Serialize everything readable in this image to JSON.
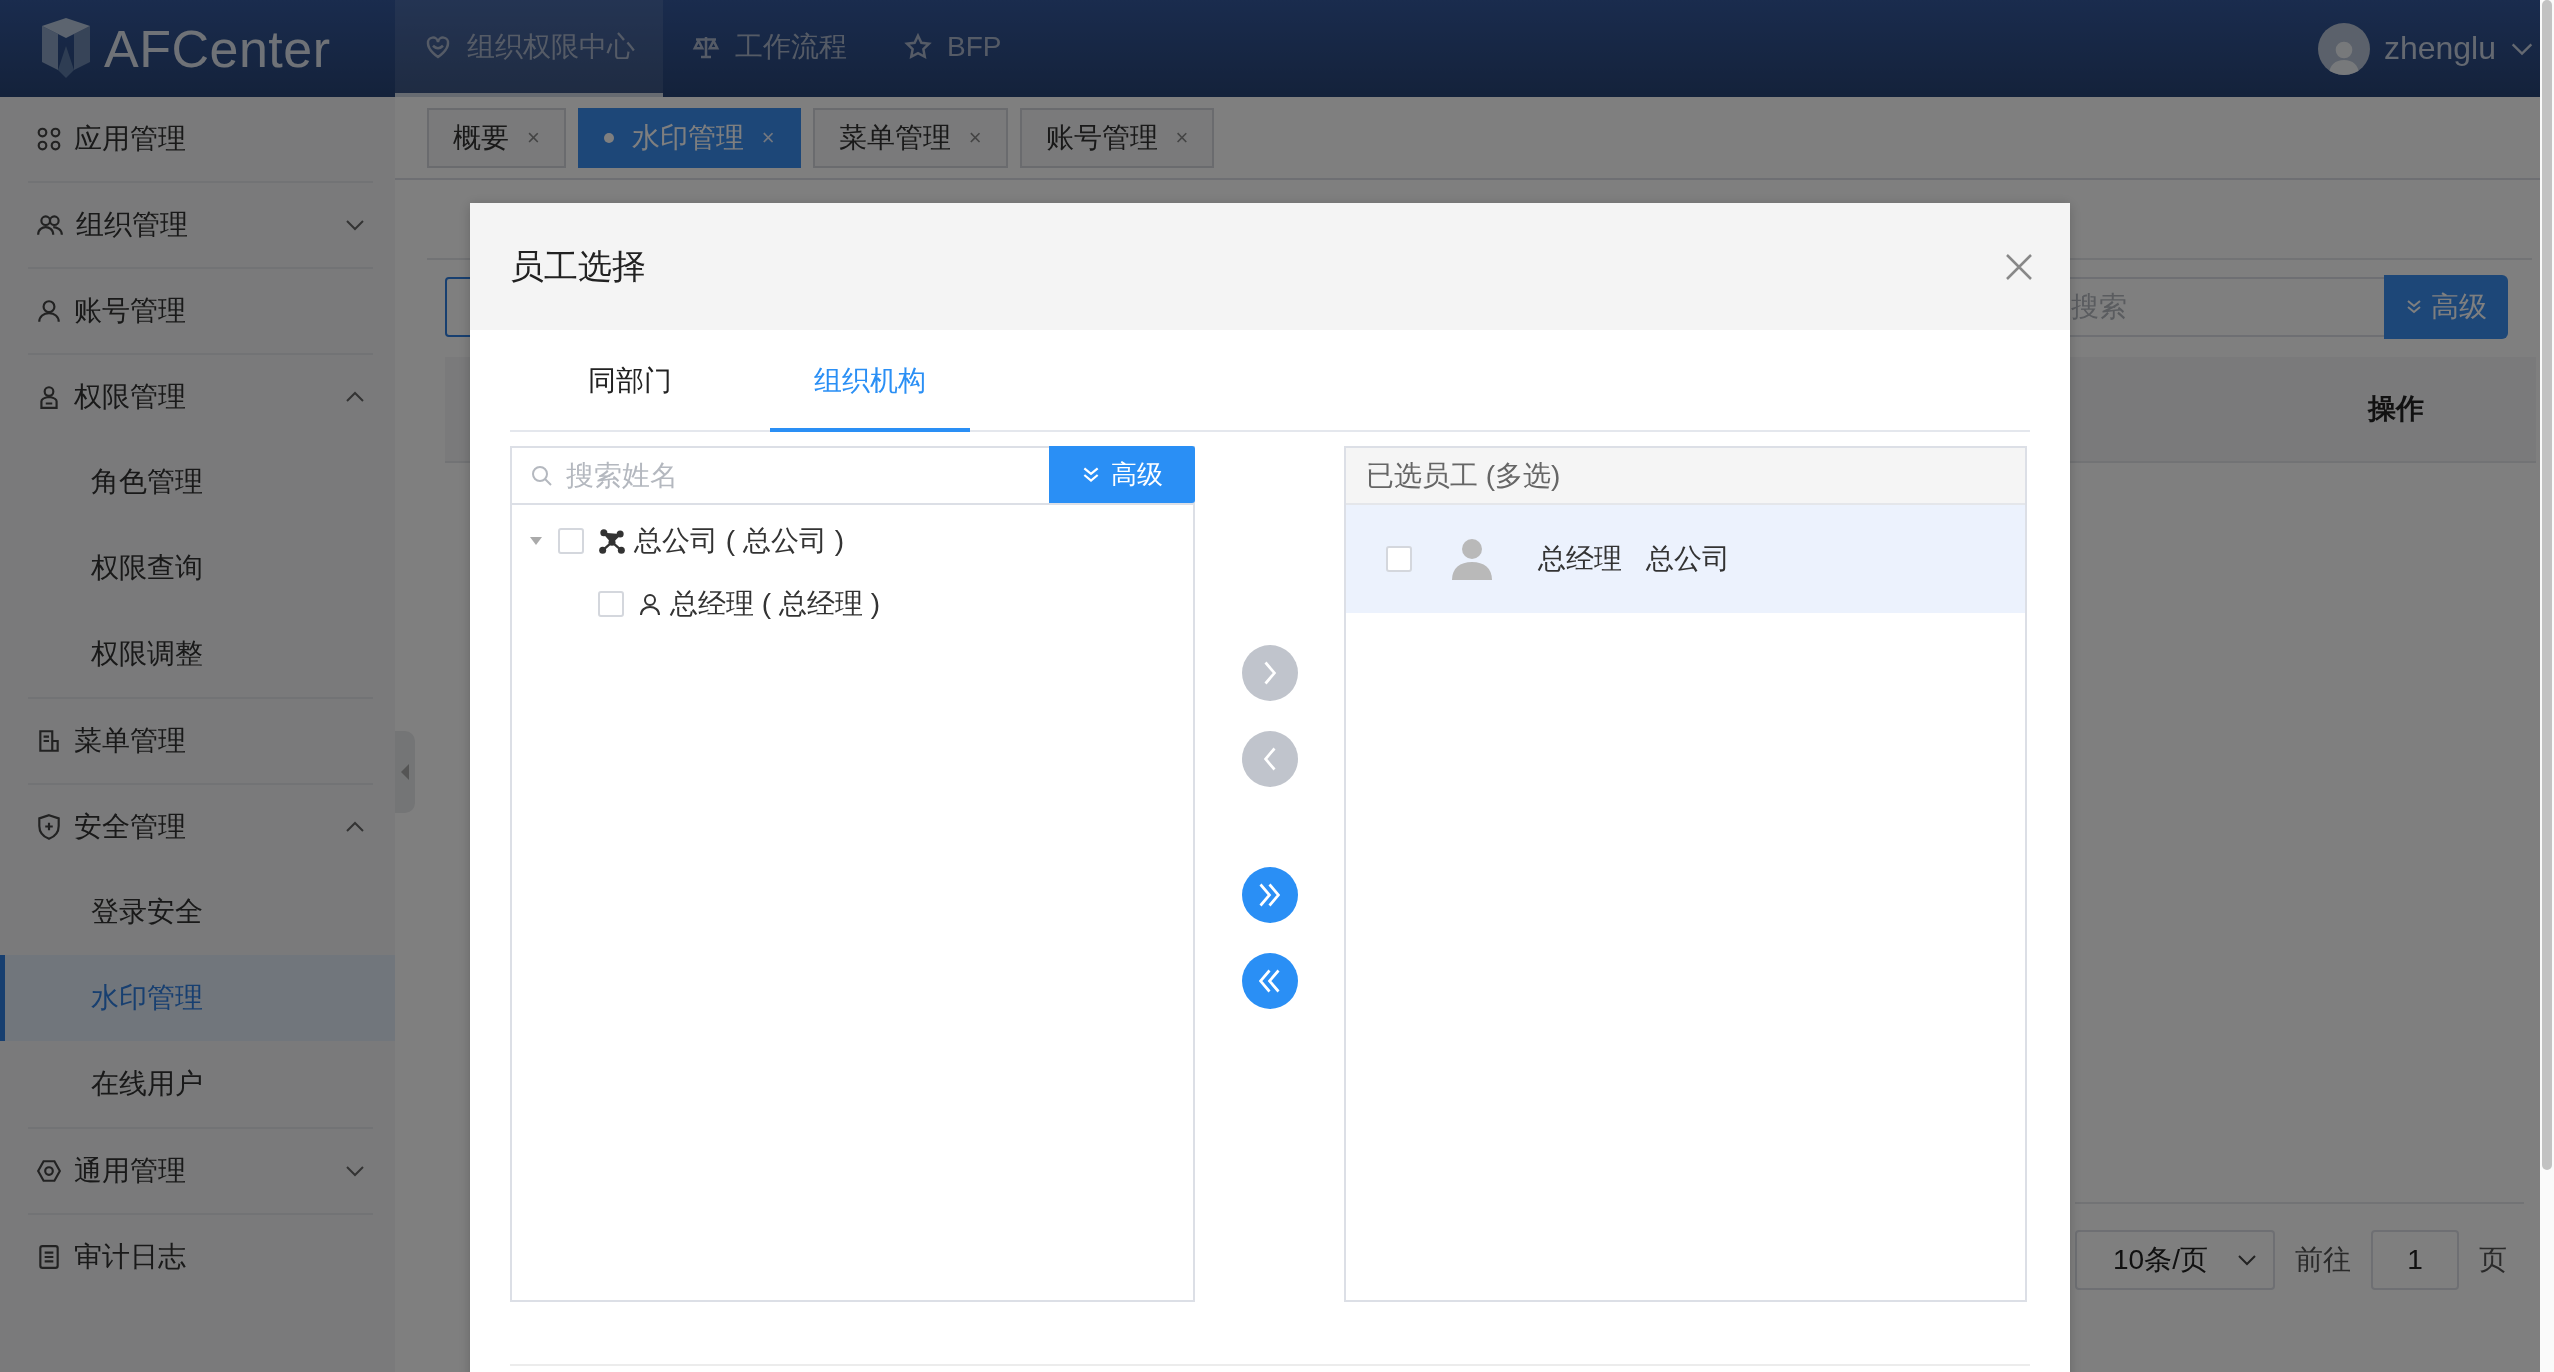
{
  "header": {
    "logo": "AFCenter",
    "nav": [
      {
        "label": "组织权限中心",
        "selected": true
      },
      {
        "label": "工作流程",
        "selected": false
      },
      {
        "label": "BFP",
        "selected": false
      }
    ],
    "user": "zhenglu"
  },
  "page_tabs": [
    {
      "label": "概要",
      "close": "×",
      "selected": false
    },
    {
      "label": "水印管理",
      "close": "×",
      "selected": true
    },
    {
      "label": "菜单管理",
      "close": "×",
      "selected": false
    },
    {
      "label": "账号管理",
      "close": "×",
      "selected": false
    }
  ],
  "sidebar": {
    "items": [
      {
        "label": "应用管理"
      },
      {
        "label": "组织管理",
        "expanded": false
      },
      {
        "label": "账号管理"
      },
      {
        "label": "权限管理",
        "expanded": true,
        "children": [
          {
            "label": "角色管理",
            "selected": false
          },
          {
            "label": "权限查询",
            "selected": false
          },
          {
            "label": "权限调整",
            "selected": false
          }
        ]
      },
      {
        "label": "菜单管理"
      },
      {
        "label": "安全管理",
        "expanded": true,
        "children": [
          {
            "label": "登录安全",
            "selected": false
          },
          {
            "label": "水印管理",
            "selected": true
          },
          {
            "label": "在线用户",
            "selected": false
          }
        ]
      },
      {
        "label": "通用管理",
        "expanded": false
      },
      {
        "label": "审计日志"
      }
    ]
  },
  "background": {
    "search": {
      "placeholder": "搜索"
    },
    "advanced_button": "高级",
    "table": {
      "columns": [
        "操作"
      ]
    },
    "pagination": {
      "page_size": "10条/页",
      "goto_label": "前往",
      "page": "1",
      "page_suffix": "页"
    }
  },
  "dialog": {
    "title": "员工选择",
    "tabs": [
      {
        "label": "同部门",
        "selected": false
      },
      {
        "label": "组织机构",
        "selected": true
      }
    ],
    "search": {
      "placeholder": "搜索姓名"
    },
    "advanced_button": "高级",
    "tree": [
      {
        "label": "总公司 ( 总公司 )",
        "kind": "org",
        "expanded": true,
        "checked": false,
        "children": [
          {
            "label": "总经理 ( 总经理 )",
            "kind": "person",
            "checked": false
          }
        ]
      }
    ],
    "transfer_buttons": [
      {
        "kind": "add",
        "disabled": true
      },
      {
        "kind": "remove",
        "disabled": true
      },
      {
        "kind": "add-all",
        "disabled": false
      },
      {
        "kind": "remove-all",
        "disabled": false
      }
    ],
    "selected_panel": {
      "title": "已选员工 (多选)",
      "rows": [
        {
          "name": "总经理",
          "department": "总公司",
          "checked": false,
          "selected": true
        }
      ]
    }
  }
}
